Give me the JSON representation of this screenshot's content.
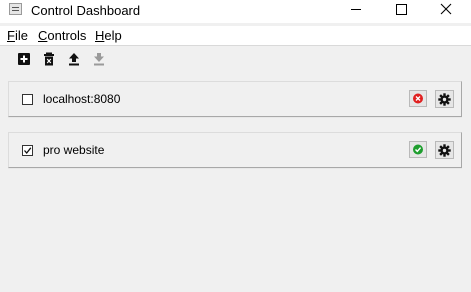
{
  "window": {
    "title": "Control Dashboard"
  },
  "menu": {
    "file": {
      "mnemonic": "F",
      "rest": "ile"
    },
    "controls": {
      "mnemonic": "C",
      "rest": "ontrols"
    },
    "help": {
      "mnemonic": "H",
      "rest": "elp"
    }
  },
  "toolbar": {
    "buttons": [
      {
        "icon": "add-icon",
        "enabled": true
      },
      {
        "icon": "delete-icon",
        "enabled": true
      },
      {
        "icon": "upload-icon",
        "enabled": true
      },
      {
        "icon": "download-icon",
        "enabled": false
      }
    ]
  },
  "targets": [
    {
      "label": "localhost:8080",
      "checked": false,
      "status": "error",
      "status_icon": "error-icon",
      "status_color": "#e02020"
    },
    {
      "label": "pro website",
      "checked": true,
      "status": "ok",
      "status_icon": "ok-icon",
      "status_color": "#1e9e2e"
    }
  ],
  "colors": {
    "window_bg": "#f0f0f0",
    "titlebar_bg": "#ffffff",
    "status_error": "#e02020",
    "status_ok": "#1e9e2e"
  }
}
